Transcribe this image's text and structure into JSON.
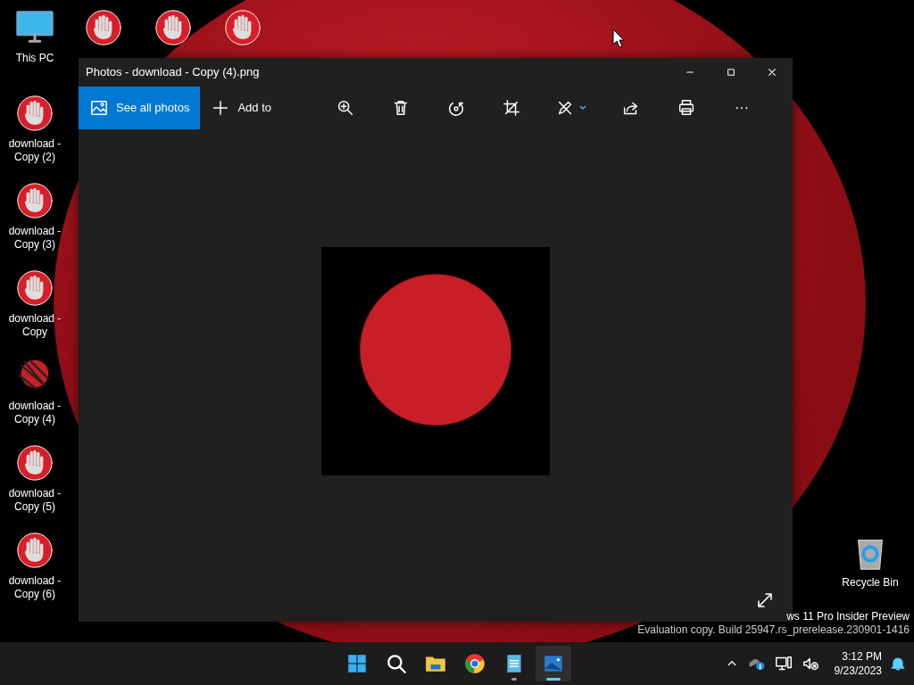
{
  "desktop_icons": [
    {
      "kind": "computer",
      "label": "This PC"
    },
    {
      "kind": "hand"
    },
    {
      "kind": "hand"
    },
    {
      "kind": "hand"
    },
    {
      "kind": "hand",
      "label": "download - Copy (2)"
    },
    {
      "kind": "hand",
      "label": "download - Copy (3)"
    },
    {
      "kind": "hand",
      "label": "download - Copy"
    },
    {
      "kind": "scribbled",
      "label": "download - Copy (4)"
    },
    {
      "kind": "hand",
      "label": "download - Copy (5)"
    },
    {
      "kind": "hand",
      "label": "download - Copy (6)"
    },
    {
      "kind": "bin",
      "label": "Recycle Bin"
    }
  ],
  "window": {
    "title": "Photos - download - Copy (4).png",
    "toolbar": [
      {
        "kind": "gallery",
        "label": "See all photos",
        "selected": true
      },
      {
        "kind": "add",
        "label": "Add to",
        "selected": false
      },
      {
        "kind": "zoom"
      },
      {
        "kind": "delete"
      },
      {
        "kind": "rotate"
      },
      {
        "kind": "crop"
      },
      {
        "kind": "edit"
      },
      {
        "kind": "share"
      },
      {
        "kind": "print"
      },
      {
        "kind": "more",
        "label": "···"
      }
    ]
  },
  "watermark": [
    "ws 11 Pro Insider Preview",
    "Evaluation copy. Build 25947.rs_prerelease.230901-1416"
  ],
  "taskbar": {
    "apps": [
      {
        "kind": "start",
        "running": false,
        "selected": false
      },
      {
        "kind": "search",
        "running": false,
        "selected": false
      },
      {
        "kind": "folder",
        "running": false,
        "selected": false
      },
      {
        "kind": "browser",
        "running": false,
        "selected": false
      },
      {
        "kind": "notepad",
        "running": true,
        "selected": false
      },
      {
        "kind": "photos",
        "running": true,
        "selected": true
      }
    ],
    "time": "3:12 PM",
    "date": "9/23/2023"
  }
}
